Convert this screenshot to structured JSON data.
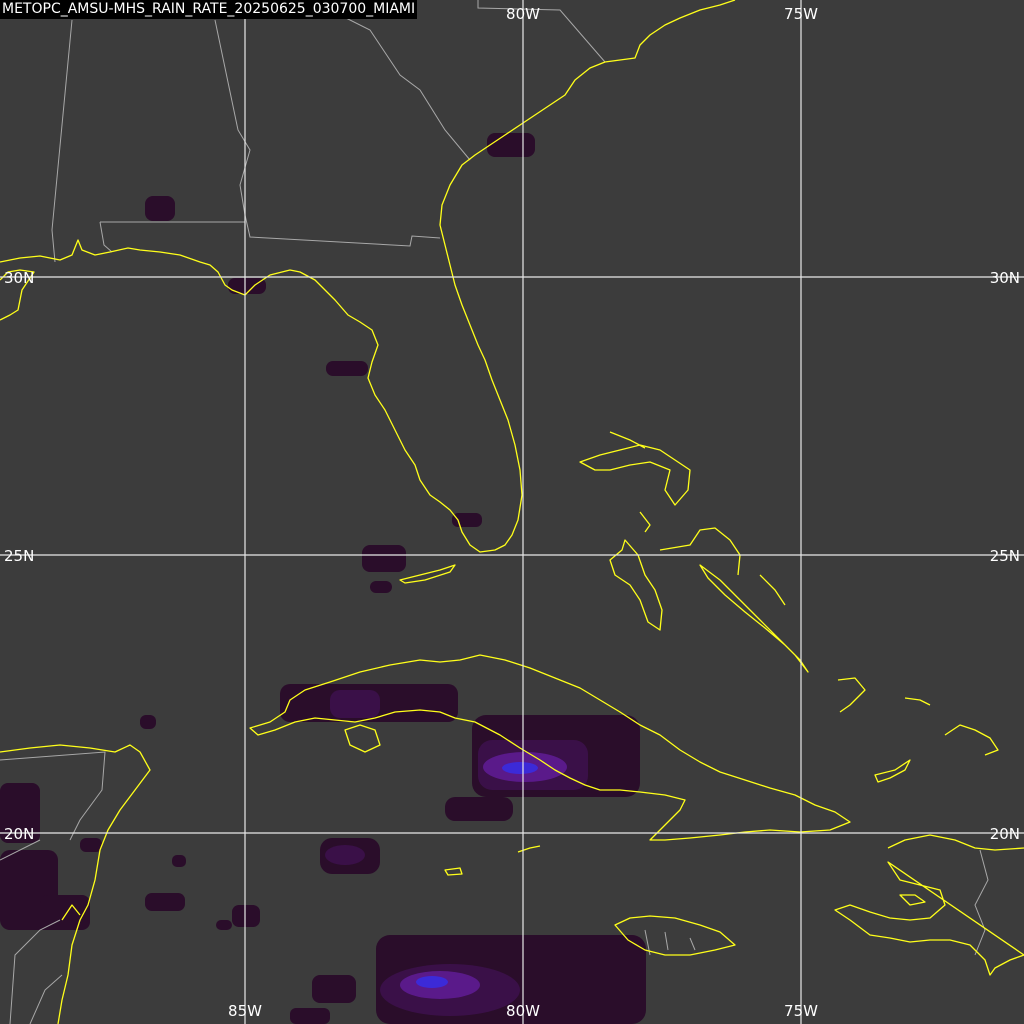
{
  "title": "METOPC_AMSU-MHS_RAIN_RATE_20250625_030700_MIAMI",
  "longitude_labels_top": [
    "80W",
    "75W"
  ],
  "longitude_labels_bottom": [
    "85W",
    "80W",
    "75W"
  ],
  "latitude_labels_left": [
    "30N",
    "25N",
    "20N"
  ],
  "latitude_labels_right": [
    "30N",
    "25N",
    "20N"
  ],
  "colors": {
    "background": "#3c3c3c",
    "coastline": "#ffff1a",
    "borders": "#a8a8a8",
    "grid": "#e8e8e8",
    "rain_light": "#2a0d2a",
    "rain_heavy": "#3c2ad8"
  }
}
